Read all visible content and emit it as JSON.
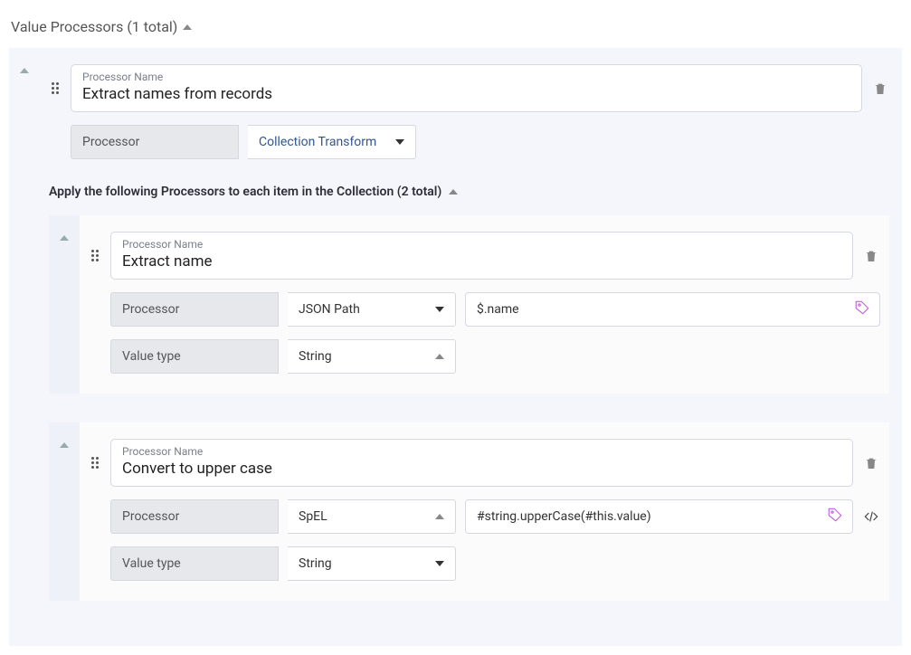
{
  "section": {
    "title": "Value Processors (1 total)"
  },
  "labels": {
    "processor_name": "Processor Name",
    "processor": "Processor",
    "value_type": "Value type"
  },
  "main_processor": {
    "name": "Extract names from records",
    "type": "Collection Transform"
  },
  "inner_heading": "Apply the following Processors to each item in the Collection (2 total)",
  "inner_processors": [
    {
      "name": "Extract name",
      "type": "JSON Path",
      "expression": "$.name",
      "value_type": "String",
      "has_code_icon": false,
      "type_caret": "down",
      "vt_caret": "up"
    },
    {
      "name": "Convert to upper case",
      "type": "SpEL",
      "expression": "#string.upperCase(#this.value)",
      "value_type": "String",
      "has_code_icon": true,
      "type_caret": "up",
      "vt_caret": "down"
    }
  ]
}
